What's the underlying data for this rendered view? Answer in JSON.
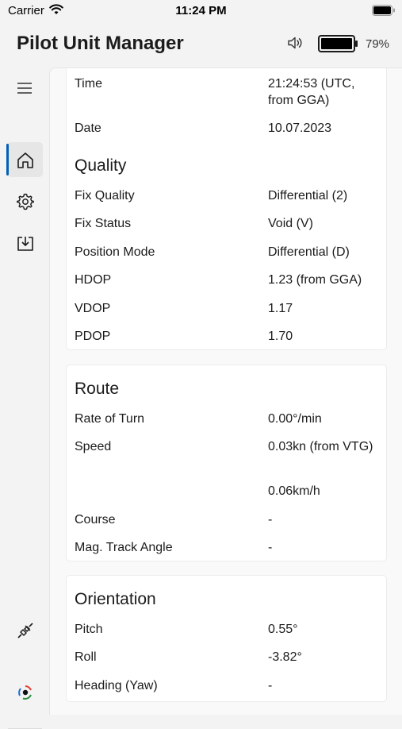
{
  "status_bar": {
    "carrier": "Carrier",
    "time": "11:24 PM"
  },
  "header": {
    "title": "Pilot Unit Manager",
    "battery_percent": "79%"
  },
  "nav": {
    "items": [
      {
        "icon": "hamburger-menu-icon"
      },
      {
        "icon": "home-icon",
        "selected": true
      },
      {
        "icon": "gear-icon"
      },
      {
        "icon": "download-icon"
      },
      {
        "icon": "plug-icon"
      },
      {
        "icon": "dot-logo-icon"
      }
    ],
    "accent_color": "#005fb8"
  },
  "sections": {
    "top": {
      "rows": [
        {
          "label": "Time",
          "value": "21:24:53 (UTC, from GGA)"
        },
        {
          "label": "Date",
          "value": "10.07.2023"
        }
      ]
    },
    "quality": {
      "title": "Quality",
      "rows": [
        {
          "label": "Fix Quality",
          "value": "Differential (2)"
        },
        {
          "label": "Fix Status",
          "value": "Void (V)"
        },
        {
          "label": "Position Mode",
          "value": "Differential (D)"
        },
        {
          "label": "HDOP",
          "value": "1.23 (from GGA)"
        },
        {
          "label": "VDOP",
          "value": "1.17"
        },
        {
          "label": "PDOP",
          "value": "1.70"
        }
      ]
    },
    "route": {
      "title": "Route",
      "rows": [
        {
          "label": "Rate of Turn",
          "value": "0.00°/min"
        },
        {
          "label": "Speed",
          "value": "0.03kn (from VTG)"
        },
        {
          "label": "",
          "value": "0.06km/h"
        },
        {
          "label": "Course",
          "value": "-"
        },
        {
          "label": "Mag. Track Angle",
          "value": "-"
        }
      ]
    },
    "orientation": {
      "title": "Orientation",
      "rows": [
        {
          "label": "Pitch",
          "value": "0.55°"
        },
        {
          "label": "Roll",
          "value": "-3.82°"
        },
        {
          "label": "Heading (Yaw)",
          "value": "-"
        }
      ]
    }
  }
}
